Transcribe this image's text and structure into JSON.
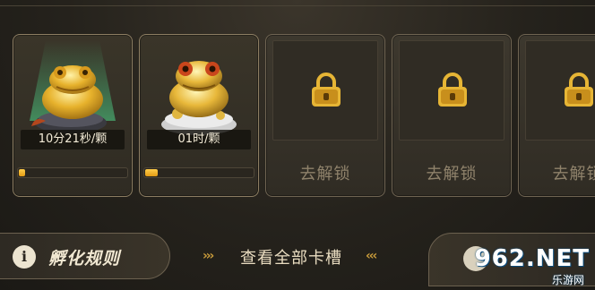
{
  "slots": [
    {
      "state": "hatching",
      "timer": "10分21秒/颗",
      "progress": 0.06
    },
    {
      "state": "hatching",
      "timer": "01时/颗",
      "progress": 0.12
    },
    {
      "state": "locked",
      "unlock_label": "去解锁"
    },
    {
      "state": "locked",
      "unlock_label": "去解锁"
    },
    {
      "state": "locked",
      "unlock_label": "去解锁"
    }
  ],
  "bottom": {
    "info_icon": "i",
    "rules_label": "孵化规则",
    "view_all_label": "查看全部卡槽",
    "chevrons_left": "›››",
    "chevrons_right": "‹‹‹"
  },
  "watermark": {
    "logo": "962.NET",
    "sub": "乐游网"
  },
  "colors": {
    "accent_gold": "#f0b629",
    "glow_green": "#4fd68a",
    "text_muted": "#8f826b"
  },
  "icons": [
    "info-icon",
    "padlock-icon",
    "frog-icon"
  ]
}
